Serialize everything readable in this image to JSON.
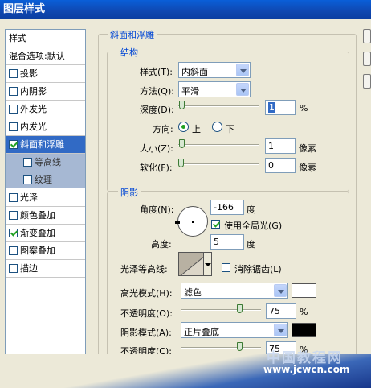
{
  "window": {
    "title": "图层样式"
  },
  "sidebar": {
    "header": "样式",
    "blend": "混合选项:默认",
    "items": [
      {
        "label": "投影",
        "checked": false
      },
      {
        "label": "内阴影",
        "checked": false
      },
      {
        "label": "外发光",
        "checked": false
      },
      {
        "label": "内发光",
        "checked": false
      },
      {
        "label": "斜面和浮雕",
        "checked": true,
        "selected": true
      },
      {
        "label": "等高线",
        "checked": false,
        "sub": true
      },
      {
        "label": "纹理",
        "checked": false,
        "sub": true
      },
      {
        "label": "光泽",
        "checked": false
      },
      {
        "label": "颜色叠加",
        "checked": false
      },
      {
        "label": "渐变叠加",
        "checked": true
      },
      {
        "label": "图案叠加",
        "checked": false
      },
      {
        "label": "描边",
        "checked": false
      }
    ]
  },
  "bevel": {
    "title": "斜面和浮雕",
    "structure": {
      "title": "结构",
      "style_label": "样式(T):",
      "style_value": "内斜面",
      "technique_label": "方法(Q):",
      "technique_value": "平滑",
      "depth_label": "深度(D):",
      "depth_value": "1",
      "depth_unit": "%",
      "direction_label": "方向:",
      "direction_up": "上",
      "direction_down": "下",
      "size_label": "大小(Z):",
      "size_value": "1",
      "size_unit": "像素",
      "soften_label": "软化(F):",
      "soften_value": "0",
      "soften_unit": "像素",
      "depth_level": 0.01,
      "size_level": 0.01,
      "soften_level": 0
    },
    "shading": {
      "title": "阴影",
      "angle_label": "角度(N):",
      "angle_value": "-166",
      "angle_unit": "度",
      "global_light_label": "使用全局光(G)",
      "altitude_label": "高度:",
      "altitude_value": "5",
      "altitude_unit": "度",
      "gloss_label": "光泽等高线:",
      "antialias_label": "消除锯齿(L)",
      "highlight_mode_label": "高光模式(H):",
      "highlight_mode_value": "滤色",
      "highlight_color": "#ffffff",
      "highlight_opacity_label": "不透明度(O):",
      "highlight_opacity_value": "75",
      "highlight_opacity_unit": "%",
      "shadow_mode_label": "阴影模式(A):",
      "shadow_mode_value": "正片叠底",
      "shadow_color": "#000000",
      "shadow_opacity_label": "不透明度(C):",
      "shadow_opacity_value": "75",
      "shadow_opacity_unit": "%",
      "highlight_opacity_level": 0.75,
      "shadow_opacity_level": 0.75
    }
  },
  "watermark": {
    "title": "中国教程网",
    "url": "www.jcwcn.com"
  }
}
